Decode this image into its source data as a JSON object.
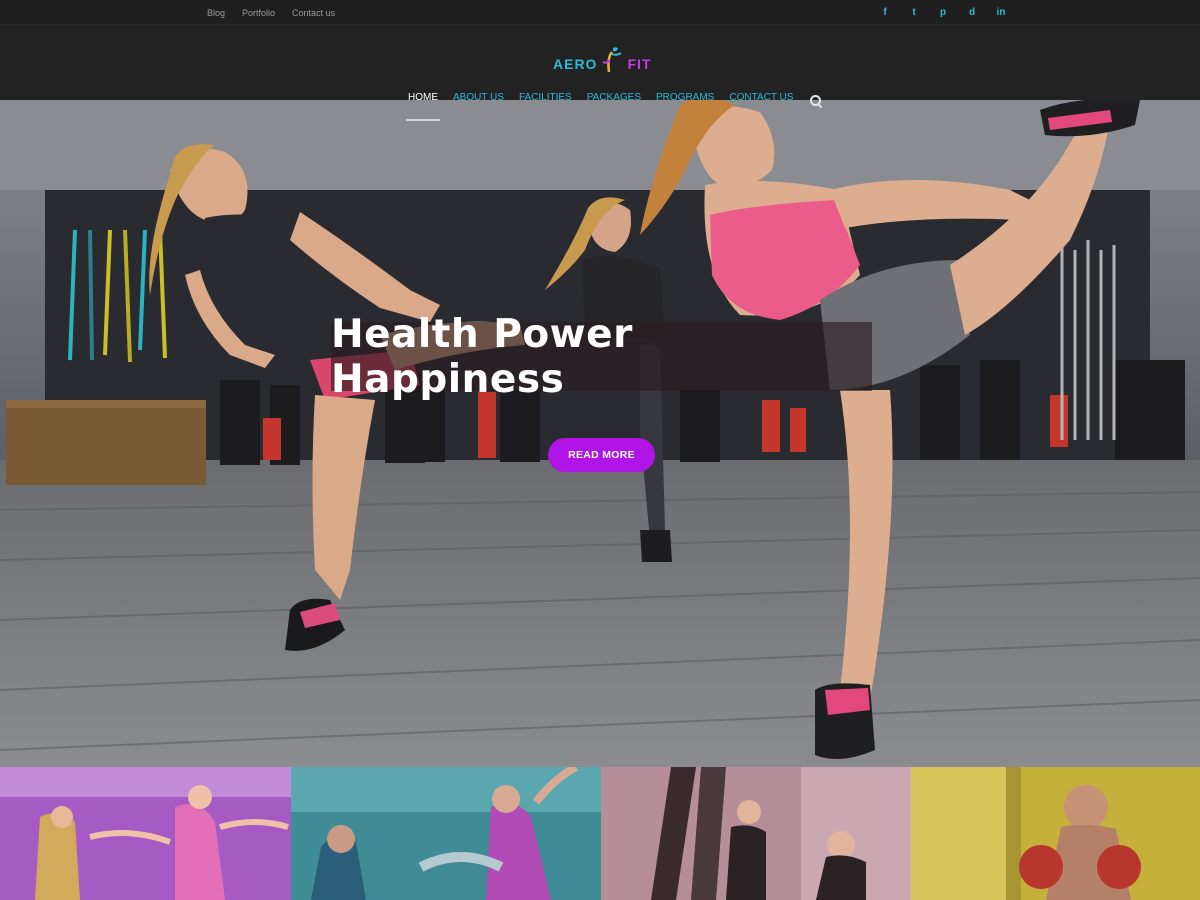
{
  "topbar": {
    "links": [
      "Blog",
      "Portfolio",
      "Contact us"
    ],
    "social_icons": [
      "facebook-icon",
      "twitter-icon",
      "pinterest-icon",
      "dribbble-icon",
      "linkedin-icon"
    ],
    "social_glyphs": [
      "f",
      "t",
      "p",
      "d",
      "in"
    ]
  },
  "logo": {
    "part1": "AERO",
    "part2": "FIT"
  },
  "nav": {
    "items": [
      "HOME",
      "ABOUT US",
      "FACILITIES",
      "PACKAGES",
      "PROGRAMS",
      "CONTACT US"
    ],
    "active": "HOME"
  },
  "hero": {
    "headline": "Health Power Happiness",
    "cta_label": "READ MORE"
  },
  "colors": {
    "accent_cyan": "#2fb9d8",
    "accent_purple": "#b014e6",
    "header_bg": "#222222"
  },
  "tiles": [
    {
      "name": "dance-class-tile",
      "tint": "#a44dc6"
    },
    {
      "name": "aerobics-class-tile",
      "tint": "#3f9aa4"
    },
    {
      "name": "aerial-yoga-tile",
      "tint": "#b88a97"
    },
    {
      "name": "boxing-tile",
      "tint": "#c7b23a"
    }
  ]
}
